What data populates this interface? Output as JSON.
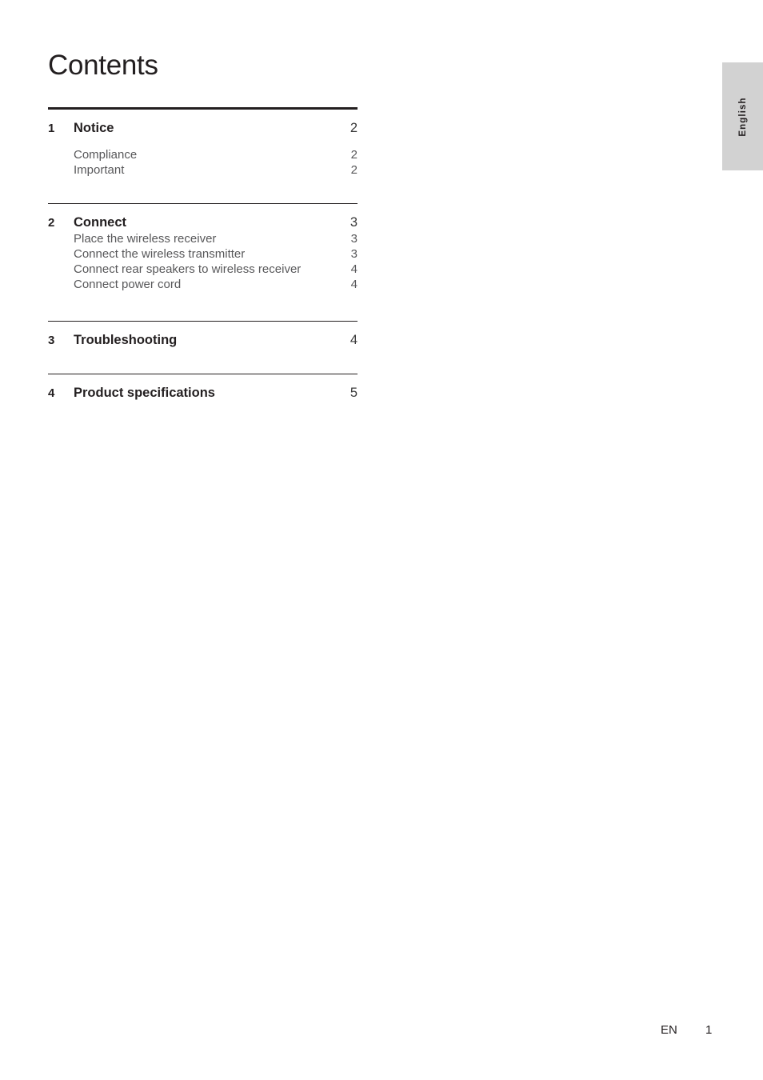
{
  "page": {
    "title": "Contents",
    "language_tab": "English",
    "footer": {
      "language_code": "EN",
      "page_number": "1"
    }
  },
  "toc": {
    "sections": [
      {
        "number": "1",
        "label": "Notice",
        "page": "2",
        "sub_gap": "gapped",
        "items": [
          {
            "label": "Compliance",
            "page": "2"
          },
          {
            "label": "Important",
            "page": "2"
          }
        ]
      },
      {
        "number": "2",
        "label": "Connect",
        "page": "3",
        "sub_gap": "tight",
        "items": [
          {
            "label": "Place the wireless receiver",
            "page": "3"
          },
          {
            "label": "Connect the wireless transmitter",
            "page": "3"
          },
          {
            "label": "Connect rear speakers to wireless receiver",
            "page": "4"
          },
          {
            "label": "Connect power cord",
            "page": "4"
          }
        ]
      },
      {
        "number": "3",
        "label": "Troubleshooting",
        "page": "4",
        "sub_gap": "tight",
        "items": []
      },
      {
        "number": "4",
        "label": "Product specifications",
        "page": "5",
        "sub_gap": "tight",
        "items": []
      }
    ]
  }
}
